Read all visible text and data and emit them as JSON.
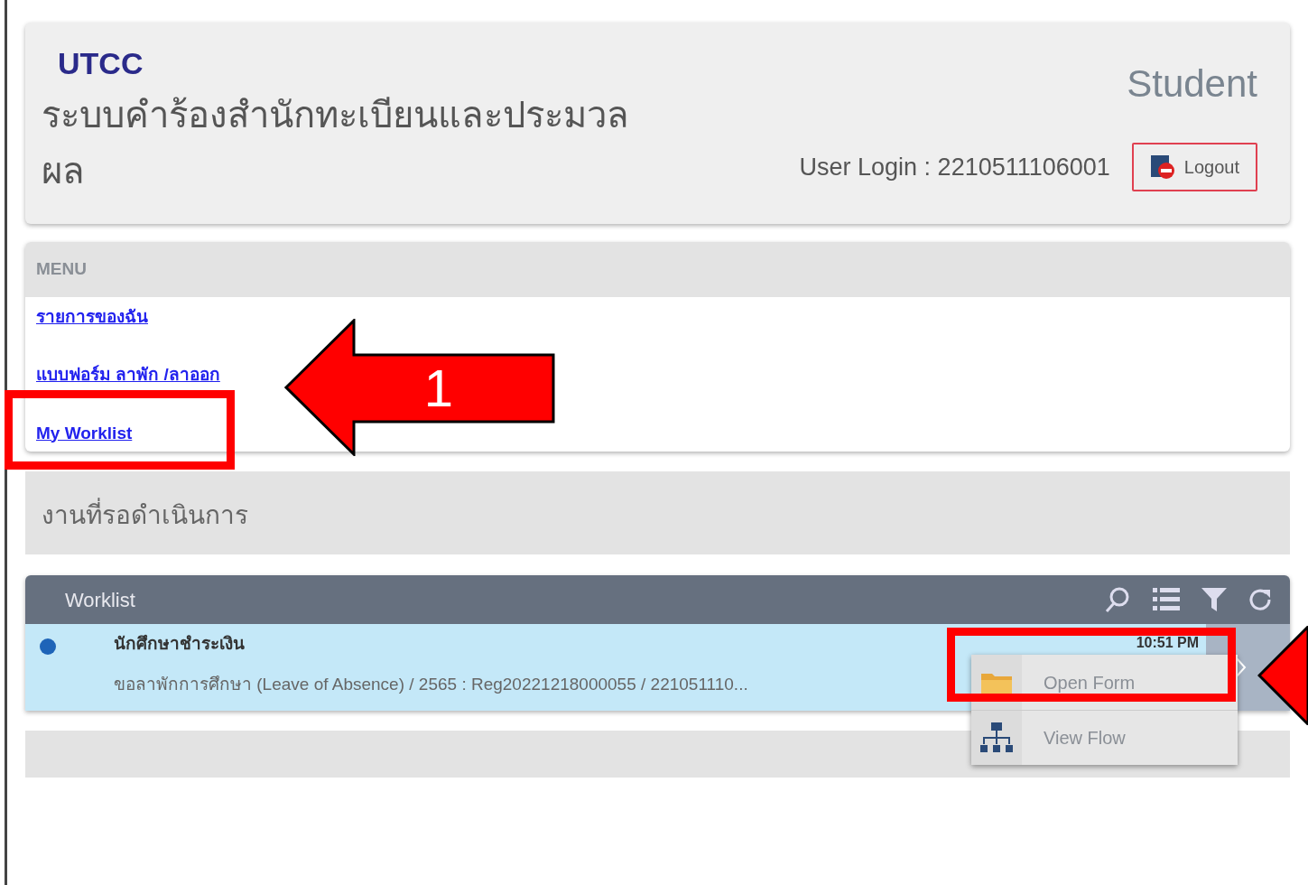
{
  "header": {
    "brand": "UTCC",
    "system_title": "ระบบคำร้องสำนักทะเบียนและประมวลผล",
    "role": "Student",
    "user_login": "User Login : 2210511106001",
    "logout_button": "Logout"
  },
  "menu": {
    "title": "MENU",
    "items": [
      {
        "label": "รายการของฉัน"
      },
      {
        "label": "แบบฟอร์ม ลาพัก /ลาออก"
      },
      {
        "label": "My Worklist"
      }
    ]
  },
  "pending_section": {
    "title": "งานที่รอดำเนินการ"
  },
  "worklist": {
    "title": "Worklist",
    "rows": [
      {
        "title": "นักศึกษาชำระเงิน",
        "subtitle": "ขอลาพักการศึกษา (Leave of Absence) / 2565 : Reg20221218000055 / 221051110...",
        "time": "10:51 PM"
      }
    ],
    "context_menu": [
      {
        "kind": "folder",
        "label": "Open Form"
      },
      {
        "kind": "flow",
        "label": "View Flow"
      }
    ]
  },
  "annotations": [
    {
      "kind": "arrow",
      "label": "1"
    }
  ]
}
